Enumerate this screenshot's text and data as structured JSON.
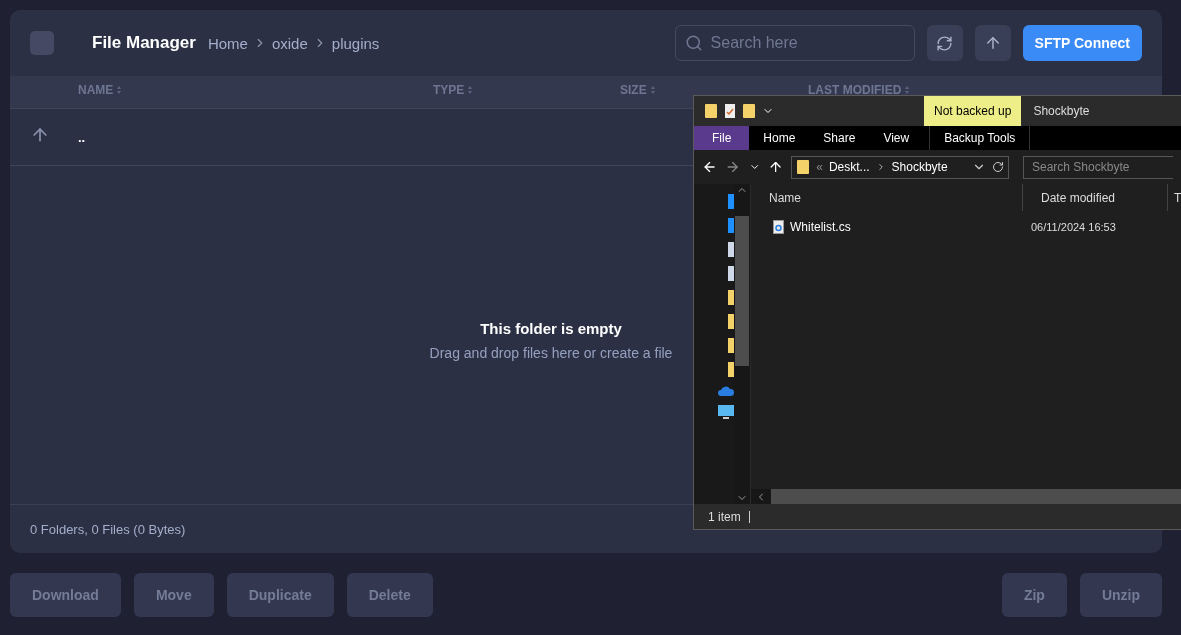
{
  "file_manager": {
    "select_all": {
      "checked": false
    },
    "title": "File Manager",
    "breadcrumbs": [
      "Home",
      "oxide",
      "plugins"
    ],
    "search": {
      "placeholder": "Search here"
    },
    "connect_button": "SFTP Connect",
    "columns": [
      "NAME",
      "TYPE",
      "SIZE",
      "LAST MODIFIED"
    ],
    "rows": [
      {
        "name": ".."
      }
    ],
    "empty_state": {
      "title": "This folder is empty",
      "hint": "Drag and drop files here or create a file"
    },
    "summary": "0 Folders, 0 Files (0 Bytes)",
    "actions_left": [
      "Download",
      "Move",
      "Duplicate",
      "Delete"
    ],
    "actions_right": [
      "Zip",
      "Unzip"
    ]
  },
  "explorer": {
    "context_tab": "Not backed up",
    "title": "Shockbyte",
    "ribbon_tabs": [
      {
        "label": "File",
        "kind": "file"
      },
      {
        "label": "Home",
        "kind": "tab"
      },
      {
        "label": "Share",
        "kind": "tab"
      },
      {
        "label": "View",
        "kind": "tab"
      },
      {
        "label": "Backup Tools",
        "kind": "context"
      }
    ],
    "path_overflow": "«",
    "path": [
      "Deskt...",
      "Shockbyte"
    ],
    "search": {
      "placeholder": "Search Shockbyte"
    },
    "columns": [
      "Name",
      "Date modified",
      "T"
    ],
    "rows": [
      {
        "name": "Whitelist.cs",
        "date": "06/11/2024 16:53"
      }
    ],
    "status": "1 item"
  }
}
